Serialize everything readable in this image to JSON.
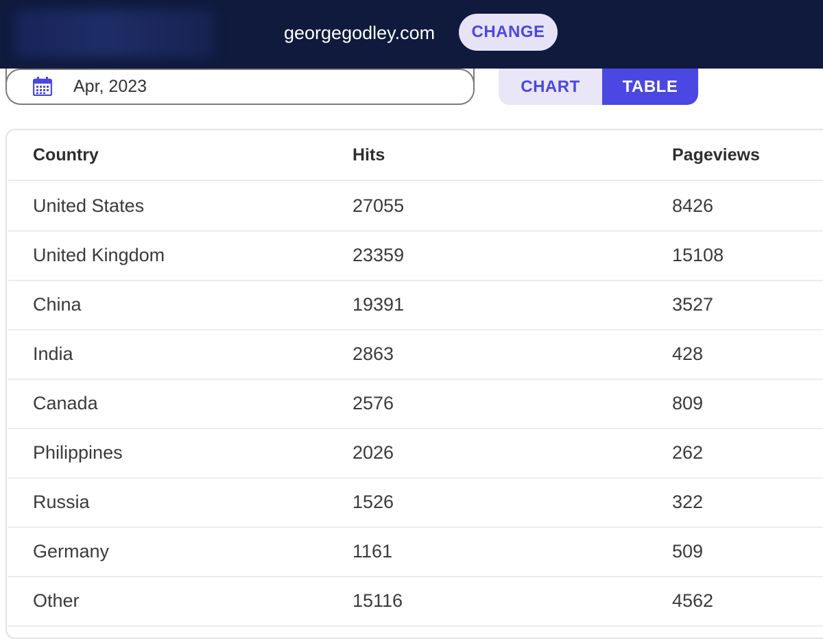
{
  "header": {
    "site": "georgegodley.com",
    "change_label": "CHANGE"
  },
  "filters": {
    "date_value": "Apr, 2023",
    "calendar_icon": "calendar-icon"
  },
  "view_toggle": {
    "chart_label": "CHART",
    "table_label": "TABLE",
    "active": "TABLE"
  },
  "table": {
    "columns": [
      "Country",
      "Hits",
      "Pageviews"
    ],
    "rows": [
      [
        "United States",
        "27055",
        "8426"
      ],
      [
        "United Kingdom",
        "23359",
        "15108"
      ],
      [
        "China",
        "19391",
        "3527"
      ],
      [
        "India",
        "2863",
        "428"
      ],
      [
        "Canada",
        "2576",
        "809"
      ],
      [
        "Philippines",
        "2026",
        "262"
      ],
      [
        "Russia",
        "1526",
        "322"
      ],
      [
        "Germany",
        "1161",
        "509"
      ],
      [
        "Other",
        "15116",
        "4562"
      ]
    ]
  },
  "colors": {
    "header_bg": "#0f1a3d",
    "accent": "#4b47e3",
    "accent_light": "#e9e6f8"
  }
}
